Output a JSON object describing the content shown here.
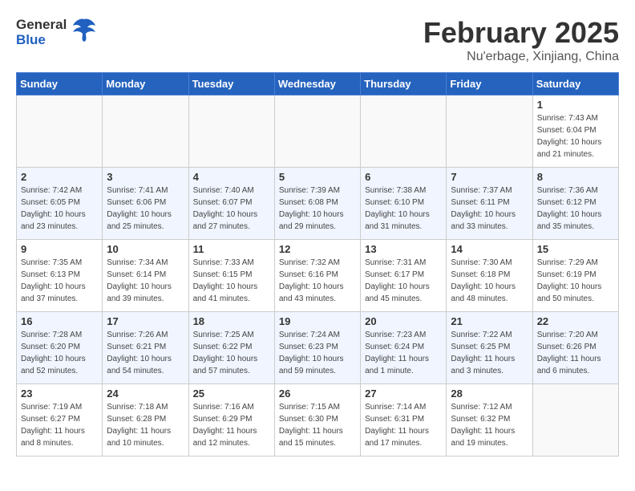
{
  "header": {
    "logo_general": "General",
    "logo_blue": "Blue",
    "month_title": "February 2025",
    "location": "Nu'erbage, Xinjiang, China"
  },
  "days_of_week": [
    "Sunday",
    "Monday",
    "Tuesday",
    "Wednesday",
    "Thursday",
    "Friday",
    "Saturday"
  ],
  "weeks": [
    {
      "cells": [
        {
          "day": null
        },
        {
          "day": null
        },
        {
          "day": null
        },
        {
          "day": null
        },
        {
          "day": null
        },
        {
          "day": null
        },
        {
          "day": 1,
          "sunrise": "7:43 AM",
          "sunset": "6:04 PM",
          "daylight": "10 hours and 21 minutes."
        }
      ]
    },
    {
      "cells": [
        {
          "day": 2,
          "sunrise": "7:42 AM",
          "sunset": "6:05 PM",
          "daylight": "10 hours and 23 minutes."
        },
        {
          "day": 3,
          "sunrise": "7:41 AM",
          "sunset": "6:06 PM",
          "daylight": "10 hours and 25 minutes."
        },
        {
          "day": 4,
          "sunrise": "7:40 AM",
          "sunset": "6:07 PM",
          "daylight": "10 hours and 27 minutes."
        },
        {
          "day": 5,
          "sunrise": "7:39 AM",
          "sunset": "6:08 PM",
          "daylight": "10 hours and 29 minutes."
        },
        {
          "day": 6,
          "sunrise": "7:38 AM",
          "sunset": "6:10 PM",
          "daylight": "10 hours and 31 minutes."
        },
        {
          "day": 7,
          "sunrise": "7:37 AM",
          "sunset": "6:11 PM",
          "daylight": "10 hours and 33 minutes."
        },
        {
          "day": 8,
          "sunrise": "7:36 AM",
          "sunset": "6:12 PM",
          "daylight": "10 hours and 35 minutes."
        }
      ]
    },
    {
      "cells": [
        {
          "day": 9,
          "sunrise": "7:35 AM",
          "sunset": "6:13 PM",
          "daylight": "10 hours and 37 minutes."
        },
        {
          "day": 10,
          "sunrise": "7:34 AM",
          "sunset": "6:14 PM",
          "daylight": "10 hours and 39 minutes."
        },
        {
          "day": 11,
          "sunrise": "7:33 AM",
          "sunset": "6:15 PM",
          "daylight": "10 hours and 41 minutes."
        },
        {
          "day": 12,
          "sunrise": "7:32 AM",
          "sunset": "6:16 PM",
          "daylight": "10 hours and 43 minutes."
        },
        {
          "day": 13,
          "sunrise": "7:31 AM",
          "sunset": "6:17 PM",
          "daylight": "10 hours and 45 minutes."
        },
        {
          "day": 14,
          "sunrise": "7:30 AM",
          "sunset": "6:18 PM",
          "daylight": "10 hours and 48 minutes."
        },
        {
          "day": 15,
          "sunrise": "7:29 AM",
          "sunset": "6:19 PM",
          "daylight": "10 hours and 50 minutes."
        }
      ]
    },
    {
      "cells": [
        {
          "day": 16,
          "sunrise": "7:28 AM",
          "sunset": "6:20 PM",
          "daylight": "10 hours and 52 minutes."
        },
        {
          "day": 17,
          "sunrise": "7:26 AM",
          "sunset": "6:21 PM",
          "daylight": "10 hours and 54 minutes."
        },
        {
          "day": 18,
          "sunrise": "7:25 AM",
          "sunset": "6:22 PM",
          "daylight": "10 hours and 57 minutes."
        },
        {
          "day": 19,
          "sunrise": "7:24 AM",
          "sunset": "6:23 PM",
          "daylight": "10 hours and 59 minutes."
        },
        {
          "day": 20,
          "sunrise": "7:23 AM",
          "sunset": "6:24 PM",
          "daylight": "11 hours and 1 minute."
        },
        {
          "day": 21,
          "sunrise": "7:22 AM",
          "sunset": "6:25 PM",
          "daylight": "11 hours and 3 minutes."
        },
        {
          "day": 22,
          "sunrise": "7:20 AM",
          "sunset": "6:26 PM",
          "daylight": "11 hours and 6 minutes."
        }
      ]
    },
    {
      "cells": [
        {
          "day": 23,
          "sunrise": "7:19 AM",
          "sunset": "6:27 PM",
          "daylight": "11 hours and 8 minutes."
        },
        {
          "day": 24,
          "sunrise": "7:18 AM",
          "sunset": "6:28 PM",
          "daylight": "11 hours and 10 minutes."
        },
        {
          "day": 25,
          "sunrise": "7:16 AM",
          "sunset": "6:29 PM",
          "daylight": "11 hours and 12 minutes."
        },
        {
          "day": 26,
          "sunrise": "7:15 AM",
          "sunset": "6:30 PM",
          "daylight": "11 hours and 15 minutes."
        },
        {
          "day": 27,
          "sunrise": "7:14 AM",
          "sunset": "6:31 PM",
          "daylight": "11 hours and 17 minutes."
        },
        {
          "day": 28,
          "sunrise": "7:12 AM",
          "sunset": "6:32 PM",
          "daylight": "11 hours and 19 minutes."
        },
        {
          "day": null
        }
      ]
    }
  ]
}
